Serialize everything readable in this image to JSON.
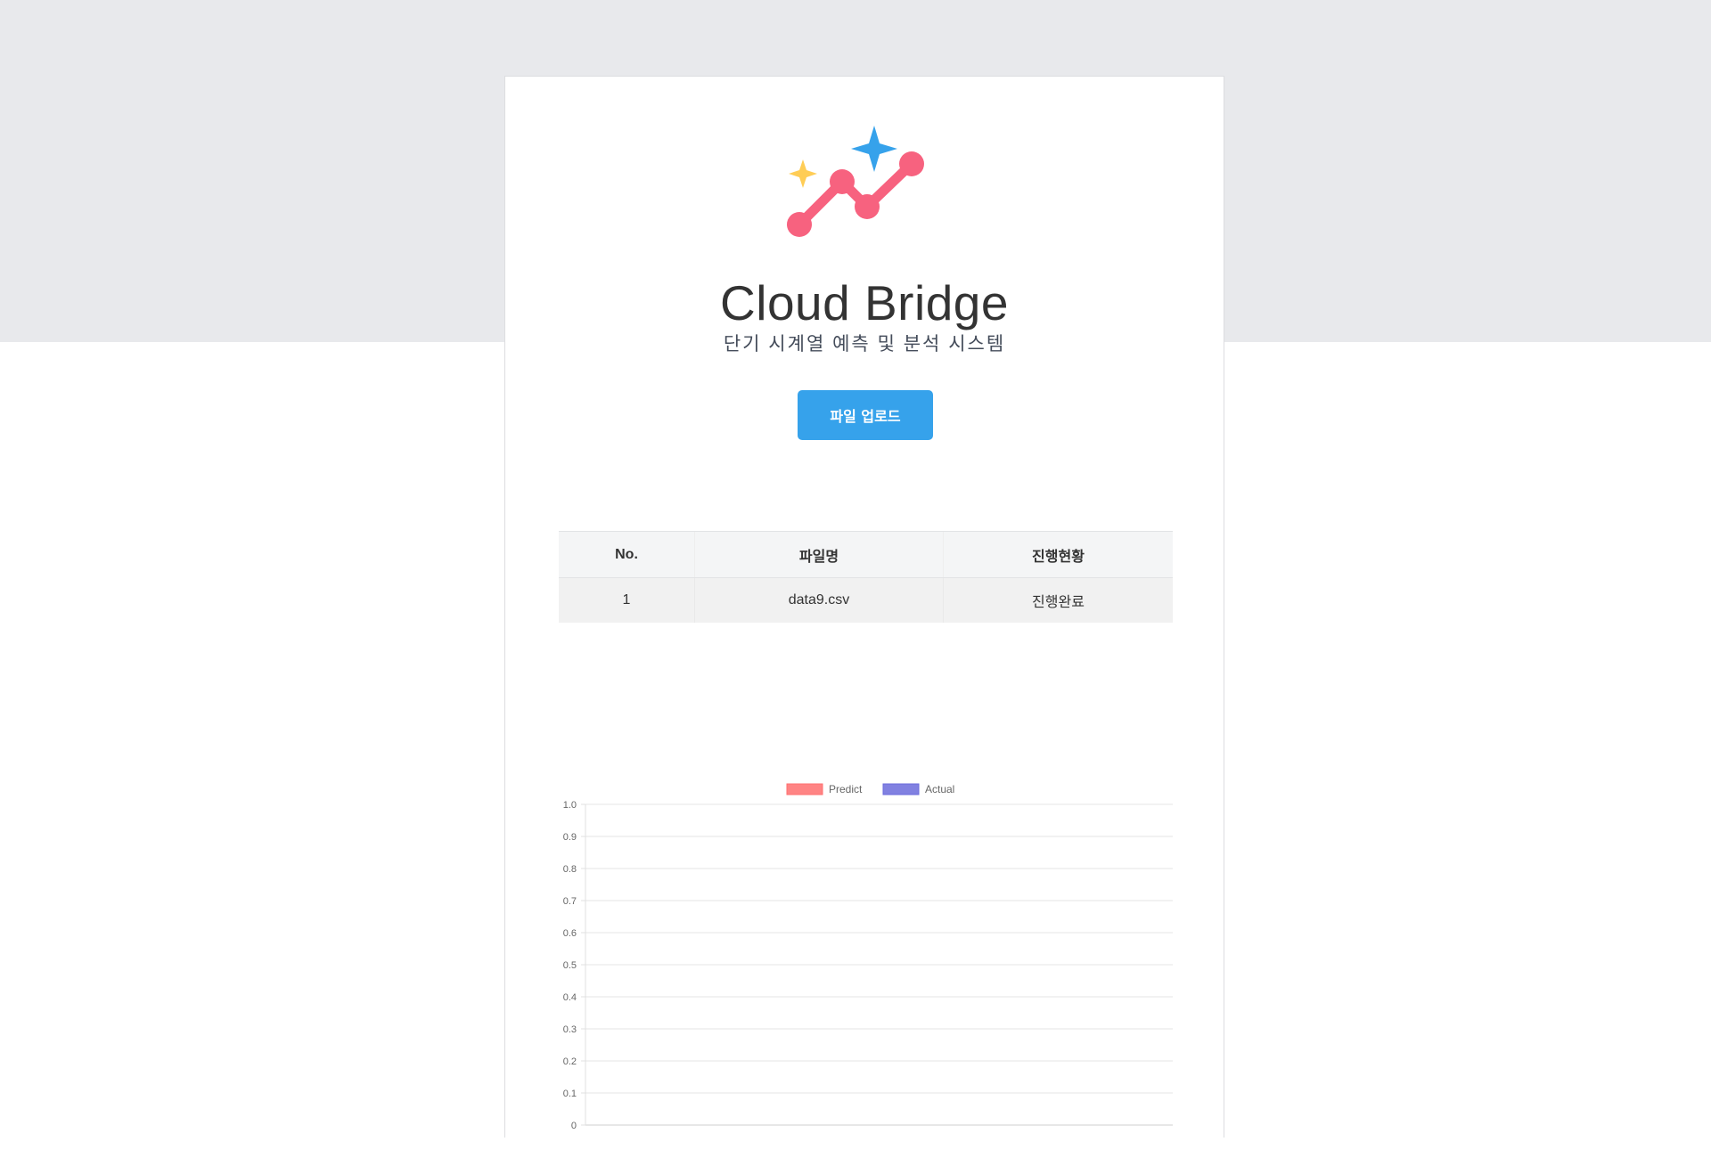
{
  "app": {
    "title": "Cloud Bridge",
    "subtitle": "단기 시계열 예측 및 분석 시스템"
  },
  "logo": {
    "icon": "trend-sparkle-logo-icon",
    "colors": {
      "line": "#f7627f",
      "sparkle_blue": "#36a2eb",
      "sparkle_yellow": "#ffcd56"
    }
  },
  "upload_button": {
    "label": "파일 업로드",
    "color": "#36a2eb"
  },
  "file_table": {
    "headers": [
      "No.",
      "파일명",
      "진행현황"
    ],
    "rows": [
      [
        "1",
        "data9.csv",
        "진행완료"
      ]
    ]
  },
  "chart_data": {
    "type": "bar",
    "categories": [],
    "series": [
      {
        "name": "Predict",
        "values": [],
        "color": "#ff6f6f"
      },
      {
        "name": "Actual",
        "values": [],
        "color": "#6b6bdc"
      }
    ],
    "ylim": [
      0,
      1
    ],
    "yticks": [
      "0",
      "0.1",
      "0.2",
      "0.3",
      "0.4",
      "0.5",
      "0.6",
      "0.7",
      "0.8",
      "0.9",
      "1.0"
    ],
    "legend": "top-center",
    "grid": true
  }
}
